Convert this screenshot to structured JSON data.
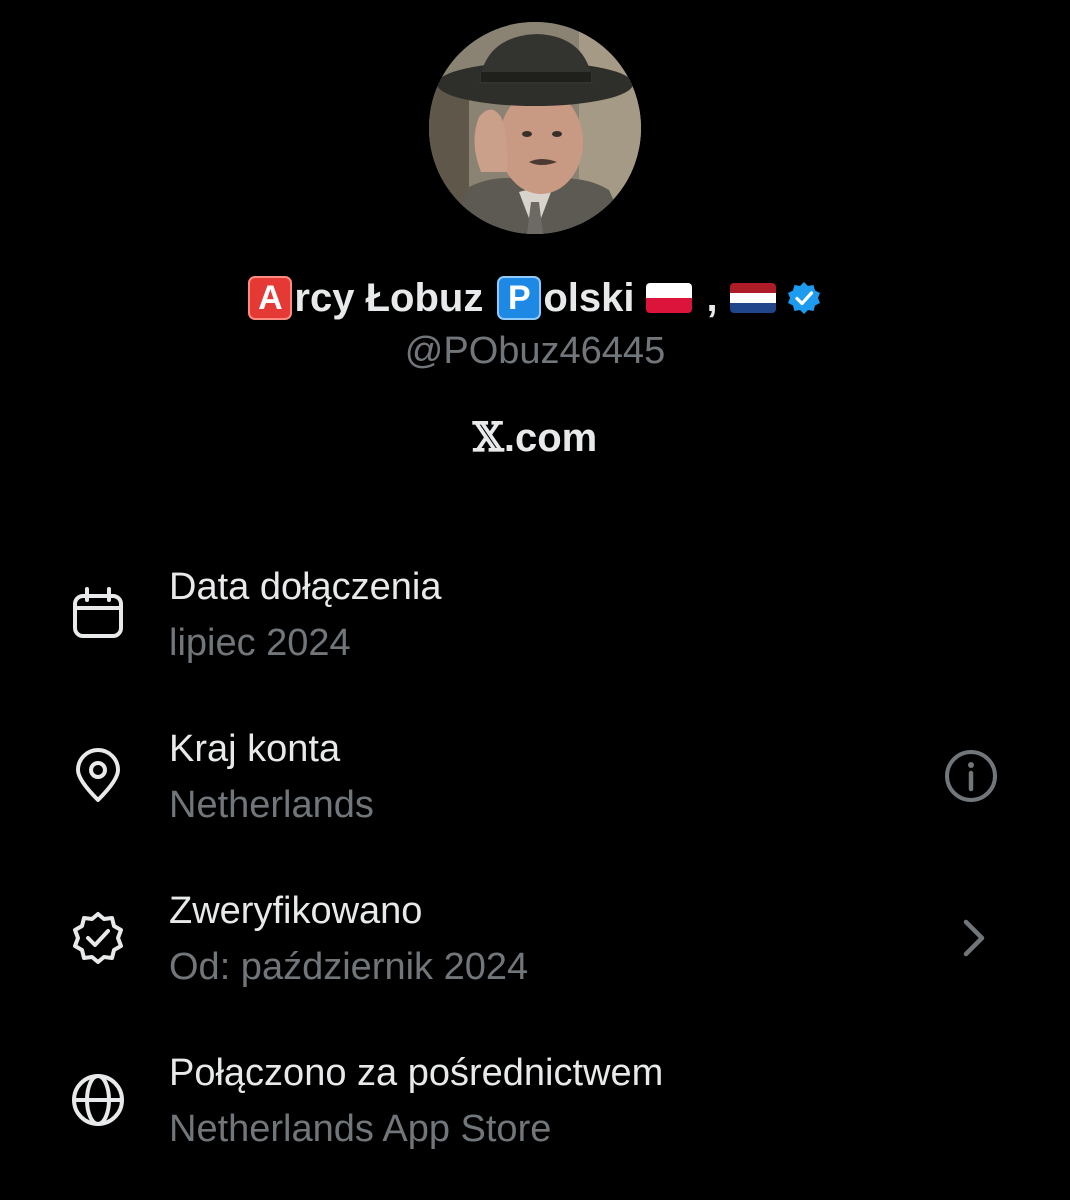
{
  "profile": {
    "name_prefix_letter": "A",
    "name_word1": "rcy Łobuz",
    "name_letter2": "P",
    "name_word2": "olski",
    "name_separator": ",",
    "handle": "@PObuz46445",
    "website": ".com",
    "website_x": "𝕏",
    "flag1": "poland-flag",
    "flag2": "netherlands-flag",
    "verified_color": "#1d9bf0"
  },
  "about": [
    {
      "title": "Data dołączenia",
      "value": "lipiec 2024",
      "icon": "calendar-icon"
    },
    {
      "title": "Kraj konta",
      "value": "Netherlands",
      "icon": "location-pin-icon",
      "action_icon": "info-icon"
    },
    {
      "title": "Zweryfikowano",
      "value": "Od: październik 2024",
      "icon": "verified-outline-icon",
      "action_icon": "chevron-right-icon"
    },
    {
      "title": "Połączono za pośrednictwem",
      "value": "Netherlands App Store",
      "icon": "globe-icon"
    }
  ],
  "colors": {
    "background": "#000000",
    "primary_text": "#e7e9ea",
    "secondary_text": "#71767b"
  }
}
